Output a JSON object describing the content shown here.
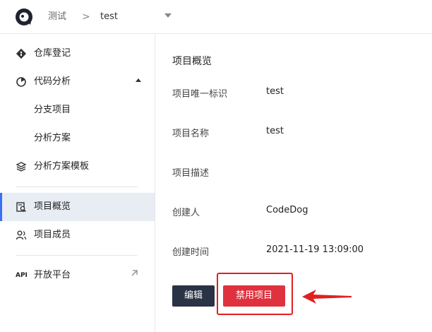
{
  "topbar": {
    "group": "测试",
    "separator": ">",
    "project": "test"
  },
  "sidebar": {
    "items": [
      {
        "label": "仓库登记",
        "icon": "git-icon"
      },
      {
        "label": "代码分析",
        "icon": "analysis-icon",
        "expanded": true
      },
      {
        "label": "分支项目"
      },
      {
        "label": "分析方案"
      },
      {
        "label": "分析方案模板",
        "icon": "layers-icon"
      },
      {
        "label": "项目概览",
        "icon": "overview-icon",
        "active": true
      },
      {
        "label": "项目成员",
        "icon": "members-icon"
      },
      {
        "label": "开放平台",
        "icon": "api-icon",
        "icon_text": "API"
      }
    ]
  },
  "main": {
    "title": "项目概览",
    "fields": [
      {
        "label": "项目唯一标识",
        "value": "test"
      },
      {
        "label": "项目名称",
        "value": "test"
      },
      {
        "label": "项目描述",
        "value": ""
      },
      {
        "label": "创建人",
        "value": "CodeDog"
      },
      {
        "label": "创建时间",
        "value": "2021-11-19 13:09:00"
      }
    ],
    "edit_label": "编辑",
    "disable_label": "禁用项目"
  },
  "colors": {
    "accent": "#3b6ef5",
    "danger": "#e0323e",
    "dark_button": "#2a3345",
    "annotation": "#e02020"
  }
}
